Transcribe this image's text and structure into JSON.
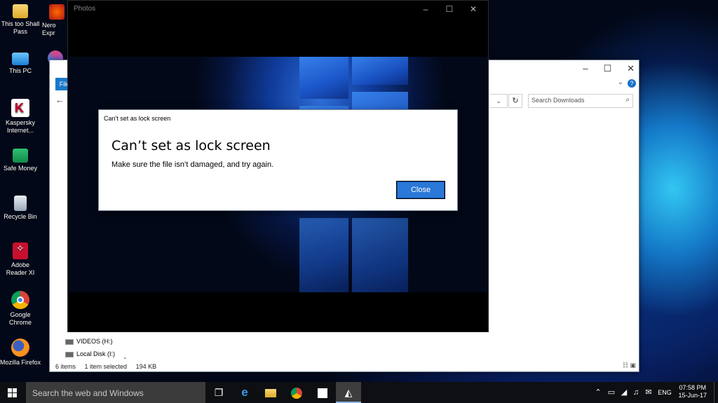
{
  "desktop": {
    "icons": [
      {
        "label": "This too Shall Pass",
        "icon": "folder-icon"
      },
      {
        "label": "This PC",
        "icon": "computer-icon"
      },
      {
        "label": "Kaspersky Internet...",
        "icon": "kaspersky-icon"
      },
      {
        "label": "Safe Money",
        "icon": "safe-money-icon"
      },
      {
        "label": "Recycle Bin",
        "icon": "recycle-bin-icon"
      },
      {
        "label": "Adobe Reader XI",
        "icon": "adobe-reader-icon"
      },
      {
        "label": "Google Chrome",
        "icon": "chrome-icon"
      },
      {
        "label": "Mozilla Firefox",
        "icon": "firefox-icon"
      }
    ],
    "second_column": [
      {
        "label": "Nero Expr",
        "icon": "nero-icon"
      }
    ]
  },
  "explorer": {
    "ribbon_tab": "File",
    "search_placeholder": "Search Downloads",
    "nav_items": [
      {
        "label": "VIDEOS (H:)"
      },
      {
        "label": "Local Disk (I:)"
      }
    ],
    "status": {
      "items": "6 items",
      "selected": "1 item selected",
      "size": "194 KB"
    }
  },
  "photos": {
    "title": "Photos"
  },
  "dialog": {
    "title": "Can't set as lock screen",
    "heading": "Can’t set as lock screen",
    "message": "Make sure the file isn’t damaged, and try again.",
    "close_label": "Close"
  },
  "taskbar": {
    "search_placeholder": "Search the web and Windows",
    "language": "ENG",
    "time": "07:58 PM",
    "date": "15-Jun-17"
  }
}
